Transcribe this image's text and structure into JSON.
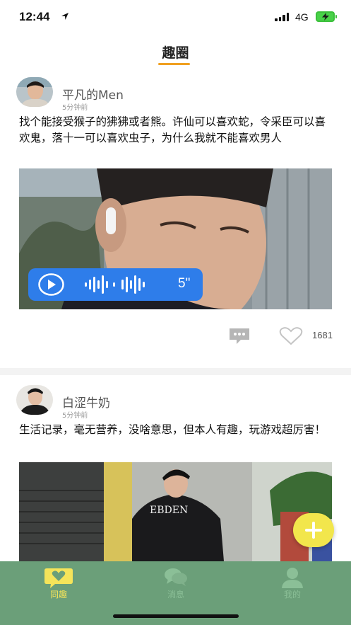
{
  "status_bar": {
    "time": "12:44",
    "network": "4G",
    "icons": [
      "location-arrow-icon",
      "signal-icon",
      "battery-charging-icon"
    ]
  },
  "header": {
    "title": "趣圈",
    "accent_color": "#f0a020"
  },
  "posts": [
    {
      "author": "平凡的Men",
      "time": "5分钟前",
      "text": "找个能接受猴子的狒狒或者熊。许仙可以喜欢蛇，令采臣可以喜欢鬼，落十一可以喜欢虫子，为什么我就不能喜欢男人",
      "voice": {
        "duration": "5\"",
        "icon": "play-icon",
        "color": "#2e7dea"
      },
      "like_count": "1681",
      "icons": [
        "comment-icon",
        "heart-icon"
      ]
    },
    {
      "author": "白涩牛奶",
      "time": "5分钟前",
      "text": "生活记录，毫无营养，没啥意思，但本人有趣，玩游戏超厉害！"
    }
  ],
  "fab": {
    "icon": "plus-icon",
    "color": "#f2e64c"
  },
  "tab_bar": {
    "background": "#6b9f79",
    "active_color": "#f5e45a",
    "tabs": [
      {
        "label": "同趣",
        "icon": "heart-chat-icon",
        "active": true
      },
      {
        "label": "消息",
        "icon": "chat-bubbles-icon",
        "active": false
      },
      {
        "label": "我的",
        "icon": "user-icon",
        "active": false
      }
    ]
  }
}
